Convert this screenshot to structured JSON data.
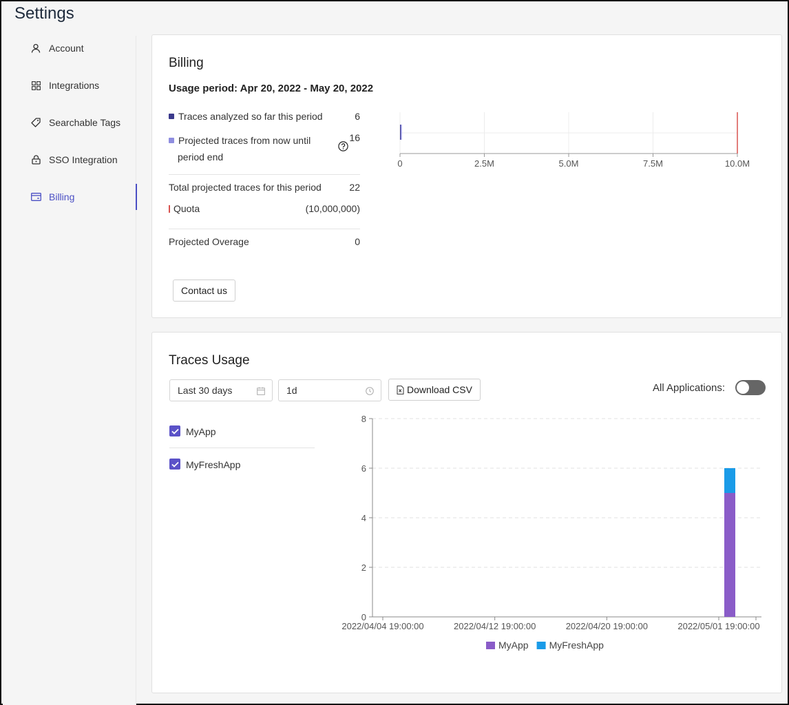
{
  "page": {
    "title": "Settings"
  },
  "sidebar": {
    "items": [
      {
        "label": "Account",
        "icon": "user-icon"
      },
      {
        "label": "Integrations",
        "icon": "grid-icon"
      },
      {
        "label": "Searchable Tags",
        "icon": "tag-icon"
      },
      {
        "label": "SSO Integration",
        "icon": "lock-icon"
      },
      {
        "label": "Billing",
        "icon": "credit-card-icon",
        "active": true
      }
    ]
  },
  "billing": {
    "title": "Billing",
    "usage_period": "Usage period: Apr 20, 2022 - May 20, 2022",
    "analyzed_label": "Traces analyzed so far this period",
    "analyzed_value": "6",
    "projected_label_line1": "Projected traces from now until",
    "projected_label_line2": "period end",
    "projected_value": "16",
    "total_label": "Total projected traces for this period",
    "total_value": "22",
    "quota_label": "Quota",
    "quota_value": "(10,000,000)",
    "overage_label": "Projected Overage",
    "overage_value": "0",
    "contact_button": "Contact us",
    "colors": {
      "analyzed": "#3b3a8c",
      "projected": "#8f8ee0",
      "quota": "#d9534f"
    }
  },
  "usage_bar_chart": {
    "type": "bar",
    "analyzed": 6,
    "projected": 16,
    "quota": 10000000,
    "xlim": [
      0,
      10000000
    ],
    "ticks": [
      "0",
      "2.5M",
      "5.0M",
      "7.5M",
      "10.0M"
    ]
  },
  "traces_usage": {
    "title": "Traces Usage",
    "date_range": "Last 30 days",
    "interval": "1d",
    "download_button": "Download CSV",
    "all_apps_label": "All Applications:",
    "all_apps_enabled": false,
    "apps": [
      {
        "name": "MyApp",
        "checked": true
      },
      {
        "name": "MyFreshApp",
        "checked": true
      }
    ]
  },
  "chart_data": {
    "type": "bar",
    "stacked": true,
    "x_tick_labels": [
      "2022/04/04 19:00:00",
      "2022/04/12 19:00:00",
      "2022/04/20 19:00:00",
      "2022/05/01 19:00:00"
    ],
    "y_ticks": [
      "0",
      "2",
      "4",
      "6",
      "8"
    ],
    "ylim": [
      0,
      8
    ],
    "categories": [
      "2022/05/03 19:00:00"
    ],
    "series": [
      {
        "name": "MyApp",
        "color": "#8a5cc8",
        "values": [
          5
        ]
      },
      {
        "name": "MyFreshApp",
        "color": "#1a9be8",
        "values": [
          1
        ]
      }
    ],
    "legend_placement": "bottom",
    "grid": true
  }
}
